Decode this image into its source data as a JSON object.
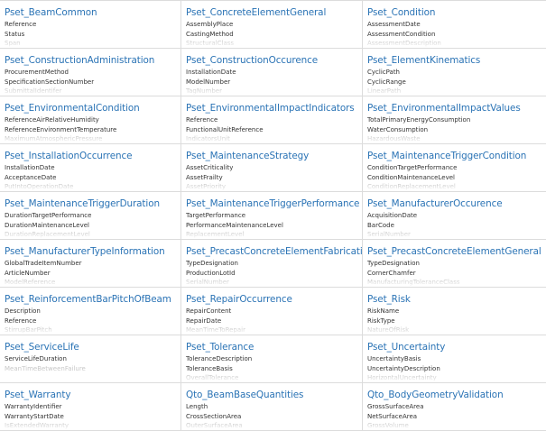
{
  "cards": [
    {
      "title": "Pset_BeamCommon",
      "props": [
        "Reference",
        "Status",
        "Span"
      ]
    },
    {
      "title": "Pset_ConcreteElementGeneral",
      "props": [
        "AssemblyPlace",
        "CastingMethod",
        "StructuralClass"
      ]
    },
    {
      "title": "Pset_Condition",
      "props": [
        "AssessmentDate",
        "AssessmentCondition",
        "AssessmentDescription"
      ]
    },
    {
      "title": "Pset_ConstructionAdministration",
      "props": [
        "ProcurementMethod",
        "SpecificationSectionNumber",
        "SubmittalIdentifer"
      ]
    },
    {
      "title": "Pset_ConstructionOccurence",
      "props": [
        "InstallationDate",
        "ModelNumber",
        "TagNumber"
      ]
    },
    {
      "title": "Pset_ElementKinematics",
      "props": [
        "CyclicPath",
        "CyclicRange",
        "LinearPath"
      ]
    },
    {
      "title": "Pset_EnvironmentalCondition",
      "props": [
        "ReferenceAirRelativeHumidity",
        "ReferenceEnvironmentTemperature",
        "MaximumAtmosphericPressure"
      ]
    },
    {
      "title": "Pset_EnvironmentalImpactIndicators",
      "props": [
        "Reference",
        "FunctionalUnitReference",
        "IndicatorsUnit"
      ]
    },
    {
      "title": "Pset_EnvironmentalImpactValues",
      "props": [
        "TotalPrimaryEnergyConsumption",
        "WaterConsumption",
        "HazardousWaste"
      ]
    },
    {
      "title": "Pset_InstallationOccurrence",
      "props": [
        "InstallationDate",
        "AcceptanceDate",
        "PutIntoOperationDate"
      ]
    },
    {
      "title": "Pset_MaintenanceStrategy",
      "props": [
        "AssetCriticality",
        "AssetFrailty",
        "AssetPriority"
      ]
    },
    {
      "title": "Pset_MaintenanceTriggerCondition",
      "props": [
        "ConditionTargetPerformance",
        "ConditionMaintenanceLevel",
        "ConditionReplacementLevel"
      ]
    },
    {
      "title": "Pset_MaintenanceTriggerDuration",
      "props": [
        "DurationTargetPerformance",
        "DurationMaintenanceLevel",
        "DurationReplacementLevel"
      ]
    },
    {
      "title": "Pset_MaintenanceTriggerPerformance",
      "props": [
        "TargetPerformance",
        "PerformanceMaintenanceLevel",
        "ReplacementLevel"
      ]
    },
    {
      "title": "Pset_ManufacturerOccurence",
      "props": [
        "AcquisitionDate",
        "BarCode",
        "SerialNumber"
      ]
    },
    {
      "title": "Pset_ManufacturerTypeInformation",
      "props": [
        "GlobalTradeItemNumber",
        "ArticleNumber",
        "ModelReference"
      ]
    },
    {
      "title": "Pset_PrecastConcreteElementFabrication",
      "props": [
        "TypeDesignation",
        "ProductionLotId",
        "SerialNumber"
      ]
    },
    {
      "title": "Pset_PrecastConcreteElementGeneral",
      "props": [
        "TypeDesignation",
        "CornerChamfer",
        "ManufacturingToleranceClass"
      ]
    },
    {
      "title": "Pset_ReinforcementBarPitchOfBeam",
      "props": [
        "Description",
        "Reference",
        "StirrupBarPitch"
      ]
    },
    {
      "title": "Pset_RepairOccurrence",
      "props": [
        "RepairContent",
        "RepairDate",
        "MeanTimeToRepair"
      ]
    },
    {
      "title": "Pset_Risk",
      "props": [
        "RiskName",
        "RiskType",
        "NatureOfRisk"
      ]
    },
    {
      "title": "Pset_ServiceLife",
      "props": [
        "ServiceLifeDuration",
        "MeanTimeBetweenFailure"
      ]
    },
    {
      "title": "Pset_Tolerance",
      "props": [
        "ToleranceDescription",
        "ToleranceBasis",
        "OverallTolerance"
      ]
    },
    {
      "title": "Pset_Uncertainty",
      "props": [
        "UncertaintyBasis",
        "UncertaintyDescription",
        "HorizontalUncertainty"
      ]
    },
    {
      "title": "Pset_Warranty",
      "props": [
        "WarrantyIdentifier",
        "WarrantyStartDate",
        "IsExtendedWarranty"
      ]
    },
    {
      "title": "Qto_BeamBaseQuantities",
      "props": [
        "Length",
        "CrossSectionArea",
        "OuterSurfaceArea"
      ]
    },
    {
      "title": "Qto_BodyGeometryValidation",
      "props": [
        "GrossSurfaceArea",
        "NetSurfaceArea",
        "GrossVolume"
      ]
    }
  ]
}
